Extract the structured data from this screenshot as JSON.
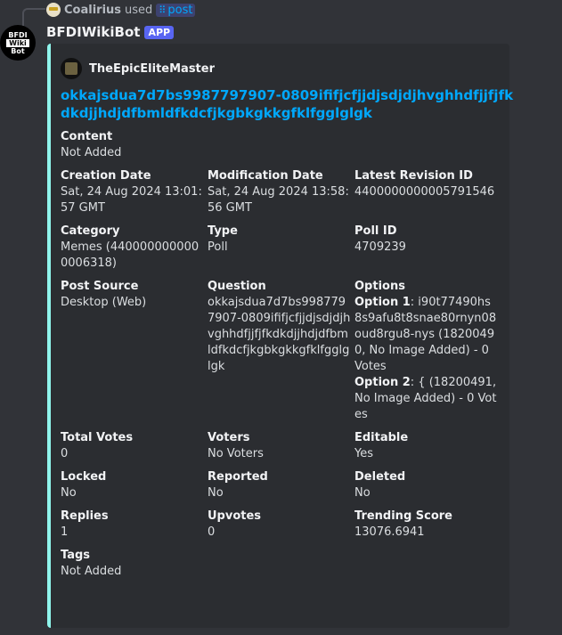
{
  "reply": {
    "user": "Coalirius",
    "used": "used",
    "command": "post"
  },
  "bot": {
    "name": "BFDIWikiBot",
    "badge": "APP",
    "avatar_lines": [
      "BFDI",
      "Wiki",
      "Bot"
    ]
  },
  "embed": {
    "accent": "#8ff5ec",
    "author": "TheEpicEliteMaster",
    "title": "okkajsdua7d7bs9987797907-0809ififjcfjjdjsdjdjhvghhdfjjfjfkdkdjjhdjdfbmldfkdcfjkgbkgkkgfklfgglglgk",
    "fields": [
      {
        "name": "Content",
        "value": "Not Added"
      },
      {
        "name": "Creation Date",
        "value": "Sat, 24 Aug 2024 13:01:57 GMT"
      },
      {
        "name": "Modification Date",
        "value": "Sat, 24 Aug 2024 13:58:56 GMT"
      },
      {
        "name": "Latest Revision ID",
        "value": "4400000000005791546"
      },
      {
        "name": "Category",
        "value": "Memes (4400000000000006318)"
      },
      {
        "name": "Type",
        "value": "Poll"
      },
      {
        "name": "Poll ID",
        "value": "4709239"
      },
      {
        "name": "Post Source",
        "value": "Desktop (Web)"
      },
      {
        "name": "Question",
        "value": "okkajsdua7d7bs9987797907-0809ififjcfjjdjsdjdjhvghhdfjjfjfkdkdjjhdjdfbmldfkdcfjkgbkgkkgfklfgglglgk"
      },
      {
        "name": "Options",
        "options": [
          {
            "label": "Option 1",
            "value": ": i90t77490hs8s9afu8t8snae80rnyn08oud8rgu8-nys (18200490, No Image Added) - 0 Votes"
          },
          {
            "label": "Option 2",
            "value": ": { (18200491, No Image Added) - 0 Votes"
          }
        ]
      },
      {
        "name": "Total Votes",
        "value": "0"
      },
      {
        "name": "Voters",
        "value": "No Voters"
      },
      {
        "name": "Editable",
        "value": "Yes"
      },
      {
        "name": "Locked",
        "value": "No"
      },
      {
        "name": "Reported",
        "value": "No"
      },
      {
        "name": "Deleted",
        "value": "No"
      },
      {
        "name": "Replies",
        "value": "1"
      },
      {
        "name": "Upvotes",
        "value": "0"
      },
      {
        "name": "Trending Score",
        "value": "13076.6941"
      },
      {
        "name": "Tags",
        "value": "Not Added"
      }
    ]
  }
}
